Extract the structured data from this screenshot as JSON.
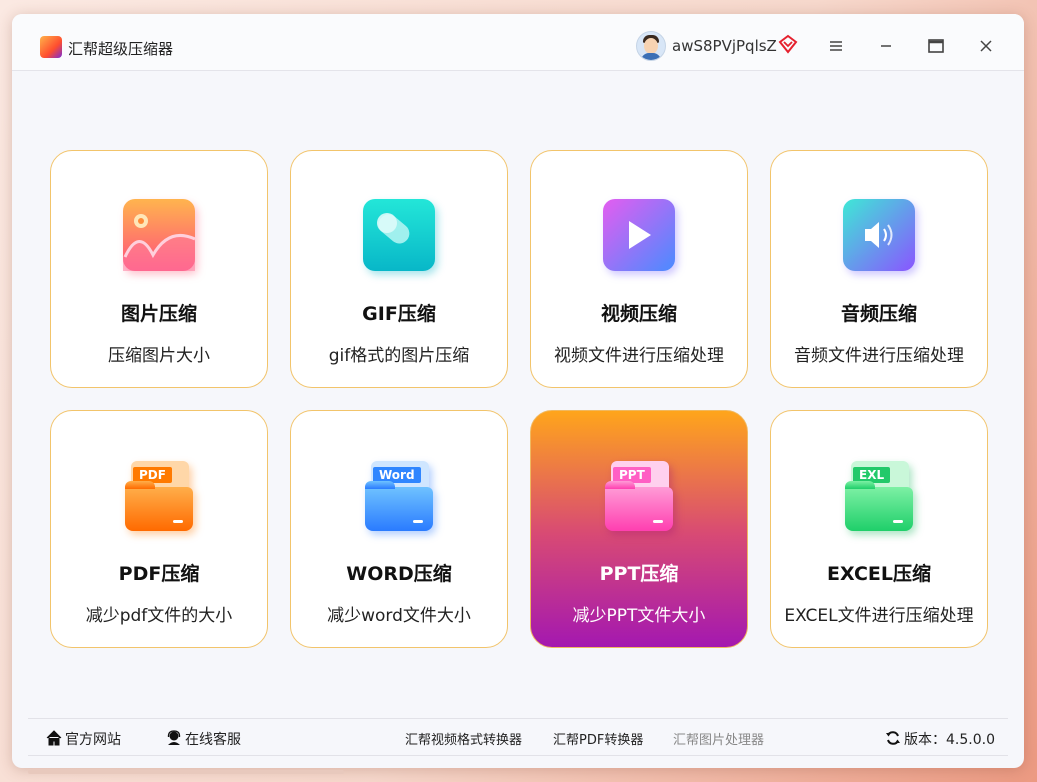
{
  "window": {
    "title": "汇帮超级压缩器",
    "username": "awS8PVjPqlsZ",
    "icons": [
      "app-logo",
      "avatar",
      "vip-diamond-icon",
      "menu-icon",
      "minimize-icon",
      "maximize-icon",
      "close-icon"
    ]
  },
  "cards": [
    {
      "title": "图片压缩",
      "subtitle": "压缩图片大小",
      "icon": "image-icon",
      "colors": [
        "#ffb44e",
        "#ff4e7d"
      ]
    },
    {
      "title": "GIF压缩",
      "subtitle": "gif格式的图片压缩",
      "icon": "gif-icon",
      "colors": [
        "#23e6d8",
        "#08b7c8"
      ]
    },
    {
      "title": "视频压缩",
      "subtitle": "视频文件进行压缩处理",
      "icon": "video-play-icon",
      "colors": [
        "#d15cf0",
        "#4a8bff"
      ]
    },
    {
      "title": "音频压缩",
      "subtitle": "音频文件进行压缩处理",
      "icon": "audio-speaker-icon",
      "colors": [
        "#3ee8d6",
        "#8a55ff"
      ]
    },
    {
      "title": "PDF压缩",
      "subtitle": "减少pdf文件的大小",
      "icon": "pdf-folder-icon",
      "tag": "PDF",
      "colors": [
        "#ffb347",
        "#ff6a00"
      ]
    },
    {
      "title": "WORD压缩",
      "subtitle": "减少word文件大小",
      "icon": "word-folder-icon",
      "tag": "Word",
      "colors": [
        "#6fc2ff",
        "#2a7bff"
      ]
    },
    {
      "title": "PPT压缩",
      "subtitle": "减少PPT文件大小",
      "icon": "ppt-folder-icon",
      "tag": "PPT",
      "colors": [
        "#ff9bd6",
        "#ff3fb0"
      ],
      "active": true
    },
    {
      "title": "EXCEL压缩",
      "subtitle": "EXCEL文件进行压缩处理",
      "icon": "excel-folder-icon",
      "tag": "EXL",
      "colors": [
        "#7df0a4",
        "#1fcf6a"
      ]
    }
  ],
  "footer": {
    "website": "官方网站",
    "support": "在线客服",
    "link1": "汇帮视频格式转换器",
    "link2": "汇帮PDF转换器",
    "link3": "汇帮图片处理器",
    "version": "版本：4.5.0.0"
  },
  "accent": "#f2c46b"
}
